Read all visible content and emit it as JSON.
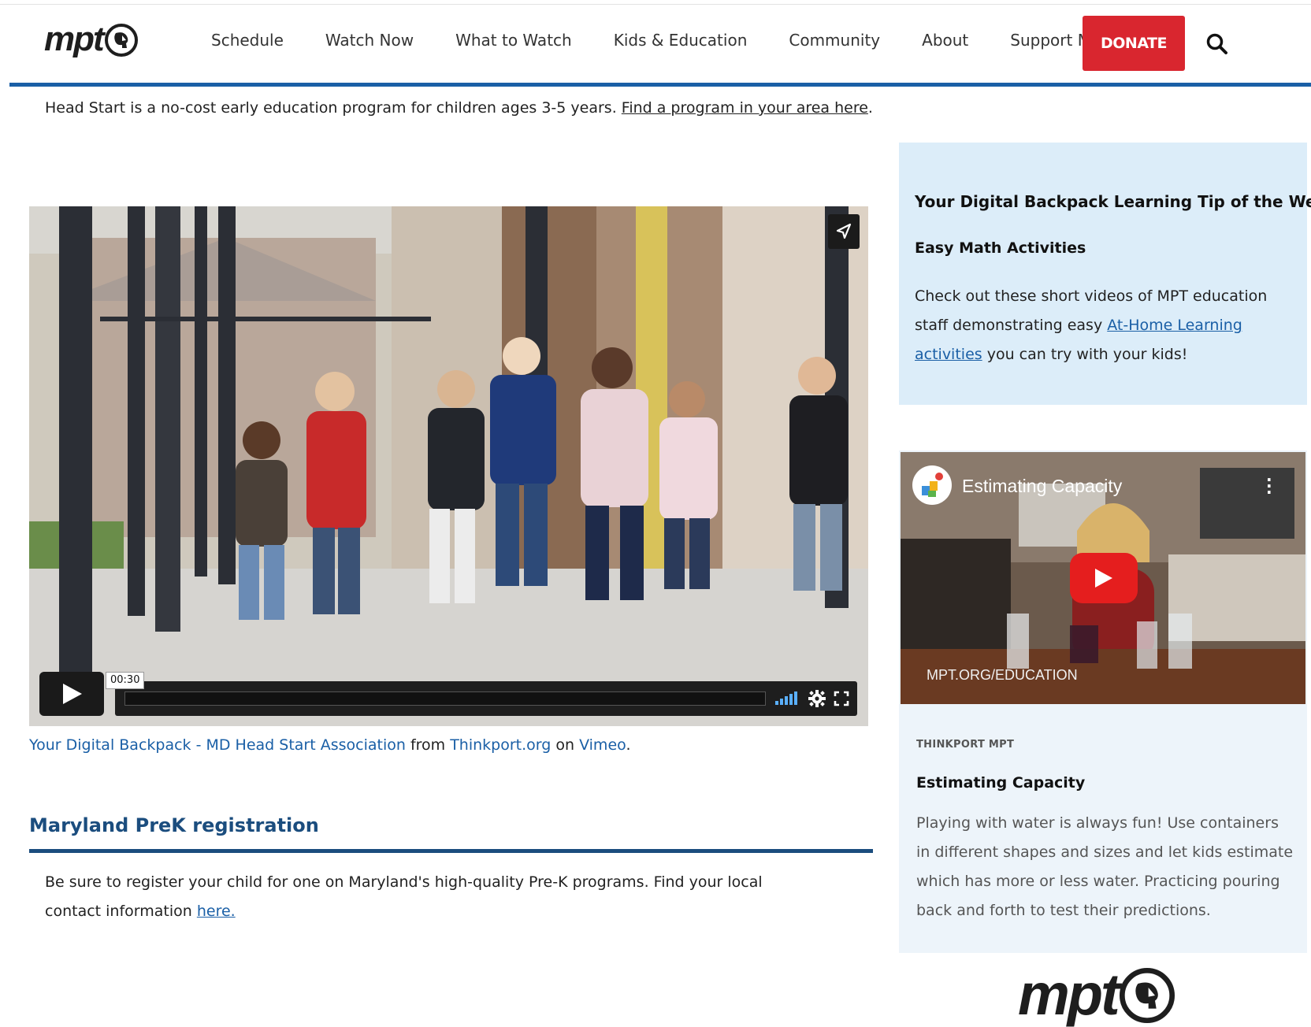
{
  "header": {
    "logo_text": "mpt",
    "nav": [
      "Schedule",
      "Watch Now",
      "What to Watch",
      "Kids & Education",
      "Community",
      "About",
      "Support MPT"
    ],
    "donate_label": "DONATE"
  },
  "intro": {
    "text": "Head Start is a no-cost early education program for children ages 3-5 years. ",
    "link": "Find a program in your area here",
    "suffix": "."
  },
  "video": {
    "time": "00:30",
    "caption_link": "Your Digital Backpack - MD Head Start Association",
    "caption_from": " from ",
    "caption_source": "Thinkport.org",
    "caption_on": " on ",
    "caption_platform": "Vimeo",
    "caption_end": "."
  },
  "prek": {
    "heading": "Maryland PreK registration",
    "text": "Be sure to register your child for one on Maryland's high-quality Pre-K programs. Find your local contact information ",
    "link": "here."
  },
  "tip": {
    "title": "Your Digital Backpack Learning Tip of the Week",
    "subtitle": "Easy Math Activities",
    "text_before": "Check out these short videos of MPT education staff demonstrating easy ",
    "link": "At-Home Learning activities",
    "text_after": " you can try with your kids!"
  },
  "card": {
    "thumb_title": "Estimating Capacity",
    "thumb_url": "MPT.ORG/EDUCATION",
    "source": "THINKPORT MPT",
    "title": "Estimating Capacity",
    "description": "Playing with water is always fun! Use containers in different shapes and sizes and let kids estimate which has more or less water. Practicing pouring back and forth to test their predictions."
  },
  "footer": {
    "logo_text": "mpt"
  },
  "colors": {
    "accent": "#1a5fa6",
    "donate": "#d9262f",
    "heading": "#1b4d7e",
    "tip_bg": "#dcedf9"
  }
}
